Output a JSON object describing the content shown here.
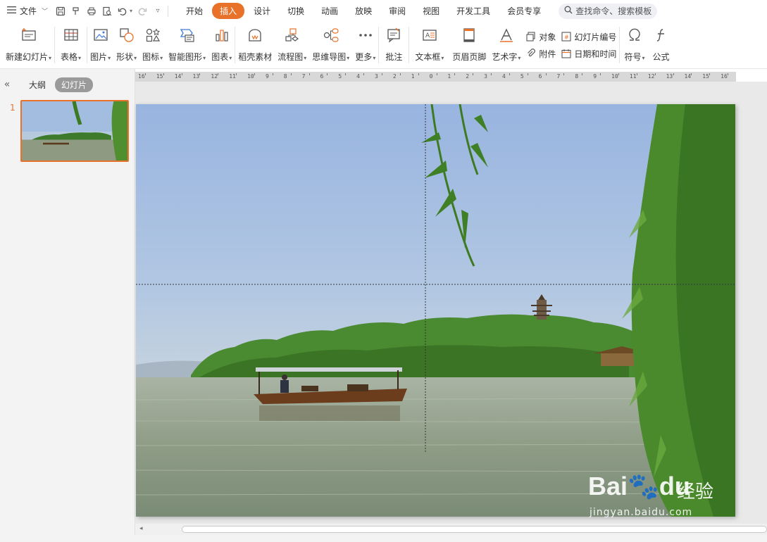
{
  "menubar": {
    "file_label": "文件",
    "tabs": [
      {
        "label": "开始"
      },
      {
        "label": "插入"
      },
      {
        "label": "设计"
      },
      {
        "label": "切换"
      },
      {
        "label": "动画"
      },
      {
        "label": "放映"
      },
      {
        "label": "审阅"
      },
      {
        "label": "视图"
      },
      {
        "label": "开发工具"
      },
      {
        "label": "会员专享"
      }
    ],
    "active_tab": "插入",
    "search_placeholder": "查找命令、搜索模板"
  },
  "ribbon": {
    "new_slide": "新建幻灯片",
    "table": "表格",
    "picture": "图片",
    "shape": "形状",
    "icon": "图标",
    "smartart": "智能图形",
    "chart": "图表",
    "daoke": "稻壳素材",
    "flowchart": "流程图",
    "mindmap": "思维导图",
    "more": "更多",
    "comment": "批注",
    "textbox": "文本框",
    "header_footer": "页眉页脚",
    "wordart": "艺术字",
    "object": "对象",
    "attachment": "附件",
    "slide_number": "幻灯片编号",
    "datetime": "日期和时间",
    "symbol": "符号",
    "formula": "公式"
  },
  "leftpane": {
    "outline_tab": "大纲",
    "slides_tab": "幻灯片",
    "slide_index": "1"
  },
  "ruler": {
    "labels": [
      "16",
      "15",
      "14",
      "13",
      "12",
      "11",
      "10",
      "9",
      "8",
      "7",
      "6",
      "5",
      "4",
      "3",
      "2",
      "1",
      "0",
      "1",
      "2",
      "3",
      "4",
      "5",
      "6",
      "7",
      "8",
      "9",
      "10",
      "11",
      "12",
      "13",
      "14",
      "15",
      "16"
    ]
  },
  "watermark": {
    "brand": "Bai",
    "brand_suffix": "du",
    "cn": "经验",
    "url": "jingyan.baidu.com"
  },
  "colors": {
    "accent": "#e8722a",
    "sky": "#9fb8da",
    "water": "#8a9a7a",
    "trees": "#3f7a2c"
  }
}
